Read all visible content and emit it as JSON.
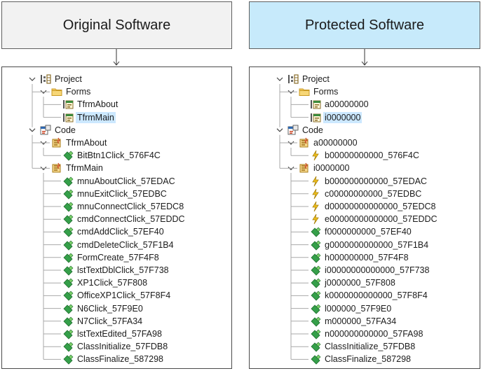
{
  "headers": {
    "left": "Original Software",
    "right": "Protected Software"
  },
  "colors": {
    "header_left_bg": "#f2f2f2",
    "header_right_bg": "#c7eafb",
    "selection": "#cce8ff",
    "folder": "#f3c85a",
    "method_green": "#35a04a",
    "method_yellow": "#f2c11a"
  },
  "trees": {
    "left": [
      {
        "label": "Project",
        "level": 0,
        "icon": "project-icon",
        "expander": true
      },
      {
        "label": "Forms",
        "level": 1,
        "icon": "folder-icon",
        "expander": true
      },
      {
        "label": "TfrmAbout",
        "level": 2,
        "icon": "form-icon"
      },
      {
        "label": "TfrmMain",
        "level": 2,
        "icon": "form-icon",
        "selected": true
      },
      {
        "label": "Code",
        "level": 0,
        "icon": "code-icon",
        "expander": true
      },
      {
        "label": "TfrmAbout",
        "level": 1,
        "icon": "class-icon",
        "expander": true
      },
      {
        "label": "BitBtn1Click_576F4C",
        "level": 2,
        "icon": "method-icon"
      },
      {
        "label": "TfrmMain",
        "level": 1,
        "icon": "class-icon",
        "expander": true
      },
      {
        "label": "mnuAboutClick_57EDAC",
        "level": 2,
        "icon": "method-icon"
      },
      {
        "label": "mnuExitClick_57EDBC",
        "level": 2,
        "icon": "method-icon"
      },
      {
        "label": "mnuConnectClick_57EDC8",
        "level": 2,
        "icon": "method-icon"
      },
      {
        "label": "cmdConnectClick_57EDDC",
        "level": 2,
        "icon": "method-icon"
      },
      {
        "label": "cmdAddClick_57EF40",
        "level": 2,
        "icon": "method-icon"
      },
      {
        "label": "cmdDeleteClick_57F1B4",
        "level": 2,
        "icon": "method-icon"
      },
      {
        "label": "FormCreate_57F4F8",
        "level": 2,
        "icon": "method-icon"
      },
      {
        "label": "lstTextDblClick_57F738",
        "level": 2,
        "icon": "method-icon"
      },
      {
        "label": "XP1Click_57F808",
        "level": 2,
        "icon": "method-icon"
      },
      {
        "label": "OfficeXP1Click_57F8F4",
        "level": 2,
        "icon": "method-icon"
      },
      {
        "label": "N6Click_57F9E0",
        "level": 2,
        "icon": "method-icon"
      },
      {
        "label": "N7Click_57FA34",
        "level": 2,
        "icon": "method-icon"
      },
      {
        "label": "lstTextEdited_57FA98",
        "level": 2,
        "icon": "method-icon"
      },
      {
        "label": "ClassInitialize_57FDB8",
        "level": 2,
        "icon": "method-icon"
      },
      {
        "label": "ClassFinalize_587298",
        "level": 2,
        "icon": "method-icon"
      }
    ],
    "right": [
      {
        "label": "Project",
        "level": 0,
        "icon": "project-icon",
        "expander": true
      },
      {
        "label": "Forms",
        "level": 1,
        "icon": "folder-icon",
        "expander": true
      },
      {
        "label": "a00000000",
        "level": 2,
        "icon": "form-icon"
      },
      {
        "label": "i0000000",
        "level": 2,
        "icon": "form-icon",
        "selected": true
      },
      {
        "label": "Code",
        "level": 0,
        "icon": "code-icon",
        "expander": true
      },
      {
        "label": "a00000000",
        "level": 1,
        "icon": "class-icon",
        "expander": true
      },
      {
        "label": "b00000000000_576F4C",
        "level": 2,
        "icon": "event-icon"
      },
      {
        "label": "i0000000",
        "level": 1,
        "icon": "class-icon",
        "expander": true
      },
      {
        "label": "b000000000000_57EDAC",
        "level": 2,
        "icon": "event-icon"
      },
      {
        "label": "c00000000000_57EDBC",
        "level": 2,
        "icon": "event-icon"
      },
      {
        "label": "d00000000000000_57EDC8",
        "level": 2,
        "icon": "event-icon"
      },
      {
        "label": "e00000000000000_57EDDC",
        "level": 2,
        "icon": "event-icon"
      },
      {
        "label": "f0000000000_57EF40",
        "level": 2,
        "icon": "method-icon"
      },
      {
        "label": "g0000000000000_57F1B4",
        "level": 2,
        "icon": "method-icon"
      },
      {
        "label": "h000000000_57F4F8",
        "level": 2,
        "icon": "method-icon"
      },
      {
        "label": "i00000000000000_57F738",
        "level": 2,
        "icon": "method-icon"
      },
      {
        "label": "j0000000_57F808",
        "level": 2,
        "icon": "method-icon"
      },
      {
        "label": "k0000000000000_57F8F4",
        "level": 2,
        "icon": "method-icon"
      },
      {
        "label": "l000000_57F9E0",
        "level": 2,
        "icon": "method-icon"
      },
      {
        "label": "m000000_57FA34",
        "level": 2,
        "icon": "method-icon"
      },
      {
        "label": "n000000000000_57FA98",
        "level": 2,
        "icon": "method-icon"
      },
      {
        "label": "ClassInitialize_57FDB8",
        "level": 2,
        "icon": "method-icon"
      },
      {
        "label": "ClassFinalize_587298",
        "level": 2,
        "icon": "method-icon"
      }
    ]
  }
}
